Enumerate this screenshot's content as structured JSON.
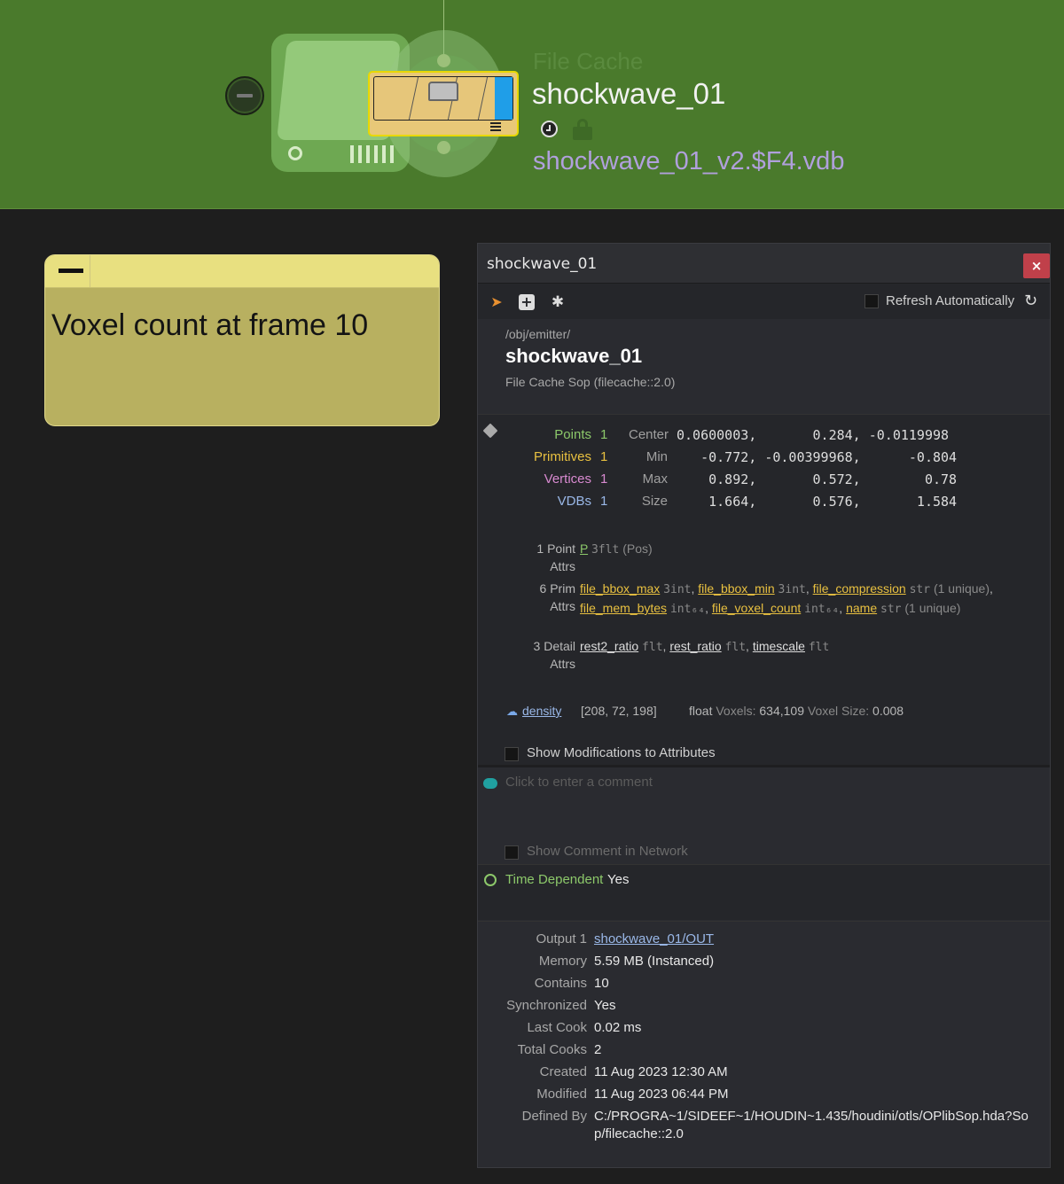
{
  "network": {
    "node_type": "File Cache",
    "node_name": "shockwave_01",
    "output_file": "shockwave_01_v2.$F4.vdb"
  },
  "sticky_note": {
    "text": "Voxel count at frame 10"
  },
  "panel": {
    "title": "shockwave_01",
    "close_label": "×",
    "toolbar": {
      "refresh_label": "Refresh Automatically"
    },
    "header": {
      "path": "/obj/emitter/",
      "name": "shockwave_01",
      "type": "File Cache Sop (filecache::2.0)"
    },
    "geometry": {
      "stats": [
        {
          "label": "Points",
          "count": "1",
          "bbox_label": "Center",
          "bbox_values": "0.0600003,       0.284, -0.0119998"
        },
        {
          "label": "Primitives",
          "count": "1",
          "bbox_label": "Min",
          "bbox_values": "   -0.772, -0.00399968,      -0.804"
        },
        {
          "label": "Vertices",
          "count": "1",
          "bbox_label": "Max",
          "bbox_values": "    0.892,       0.572,        0.78"
        },
        {
          "label": "VDBs",
          "count": "1",
          "bbox_label": "Size",
          "bbox_values": "    1.664,       0.576,       1.584"
        }
      ],
      "point_attrs": {
        "label_line1": "1 Point",
        "label_line2": "Attrs",
        "attrs": [
          {
            "name": "P",
            "type": "3flt",
            "note": "(Pos)"
          }
        ]
      },
      "prim_attrs": {
        "label_line1": "6 Prim",
        "label_line2": "Attrs",
        "attrs": [
          {
            "name": "file_bbox_max",
            "type": "3int"
          },
          {
            "name": "file_bbox_min",
            "type": "3int"
          },
          {
            "name": "file_compression",
            "type": "str",
            "note": "(1 unique)"
          },
          {
            "name": "file_mem_bytes",
            "type": "int₆₄"
          },
          {
            "name": "file_voxel_count",
            "type": "int₆₄"
          },
          {
            "name": "name",
            "type": "str",
            "note": "(1 unique)"
          }
        ]
      },
      "detail_attrs": {
        "label_line1": "3 Detail",
        "label_line2": "Attrs",
        "attrs": [
          {
            "name": "rest2_ratio",
            "type": "flt"
          },
          {
            "name": "rest_ratio",
            "type": "flt"
          },
          {
            "name": "timescale",
            "type": "flt"
          }
        ]
      },
      "volume": {
        "name": "density",
        "resolution": "[208, 72, 198]",
        "type": "float",
        "voxels_label": "Voxels:",
        "voxels": "634,109",
        "voxel_size_label": "Voxel Size:",
        "voxel_size": "0.008"
      },
      "show_mods_label": "Show Modifications to Attributes"
    },
    "comment": {
      "placeholder": "Click to enter a comment",
      "show_in_network_label": "Show Comment in Network"
    },
    "time_dependent": {
      "label": "Time Dependent",
      "value": "Yes"
    },
    "meta": [
      {
        "key": "Output 1",
        "value": "shockwave_01/OUT",
        "link": true
      },
      {
        "key": "Memory",
        "value": "5.59 MB (Instanced)"
      },
      {
        "key": "Contains",
        "value": "10"
      },
      {
        "key": "Synchronized",
        "value": "Yes"
      },
      {
        "key": "Last Cook",
        "value": "0.02 ms"
      },
      {
        "key": "Total Cooks",
        "value": "2"
      },
      {
        "key": "Created",
        "value": "11 Aug 2023 12:30 AM"
      },
      {
        "key": "Modified",
        "value": "11 Aug 2023 06:44 PM"
      },
      {
        "key": "Defined By",
        "value": "C:/PROGRA~1/SIDEEF~1/HOUDIN~1.435/houdini/otls/OPlibSop.hda?Sop/filecache::2.0"
      }
    ]
  }
}
